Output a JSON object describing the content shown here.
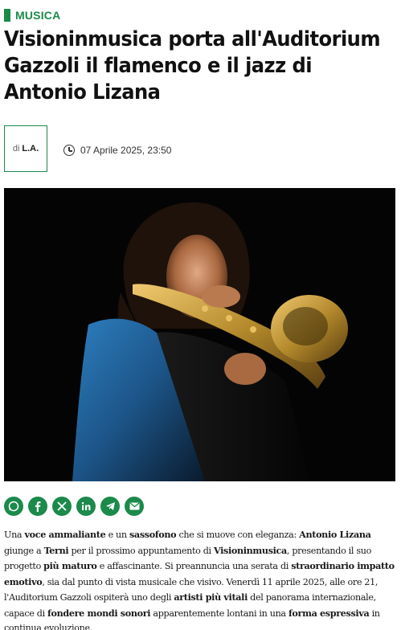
{
  "category": {
    "label": "MUSICA",
    "color": "#1b8a4a"
  },
  "headline": "Visioninmusica porta all'Auditorium Gazzoli il flamenco e il jazz di Antonio Lizana",
  "author": {
    "prefix": "di",
    "name": "L.A."
  },
  "date": "07 Aprile 2025, 23:50",
  "share": [
    {
      "icon": "whatsapp-icon"
    },
    {
      "icon": "facebook-icon"
    },
    {
      "icon": "x-icon"
    },
    {
      "icon": "linkedin-icon"
    },
    {
      "icon": "telegram-icon"
    },
    {
      "icon": "email-icon"
    }
  ],
  "body": {
    "s1": "Una ",
    "b1": "voce ammaliante",
    "s2": " e un ",
    "b2": "sassofono",
    "s3": " che si muove con eleganza: ",
    "b3": "Antonio Lizana",
    "s4": " giunge a ",
    "b4": "Terni",
    "s5": " per il prossimo appuntamento di ",
    "b5": "Visioninmusica",
    "s6": ", presentando il suo progetto ",
    "b6": "più maturo",
    "s7": " e affascinante. Si preannuncia una serata di ",
    "b7": "straordinario impatto emotivo",
    "s8": ", sia dal punto di vista musicale che visivo. Venerdì 11 aprile 2025, alle ore 21, l'Auditorium Gazzoli ospiterà uno degli ",
    "b8": "artisti più vitali",
    "s9": " del panorama internazionale, capace di ",
    "b9": "fondere mondi sonori",
    "s10": " apparentemente lontani in una ",
    "b10": "forma espressiva",
    "s11": " in continua evoluzione."
  }
}
